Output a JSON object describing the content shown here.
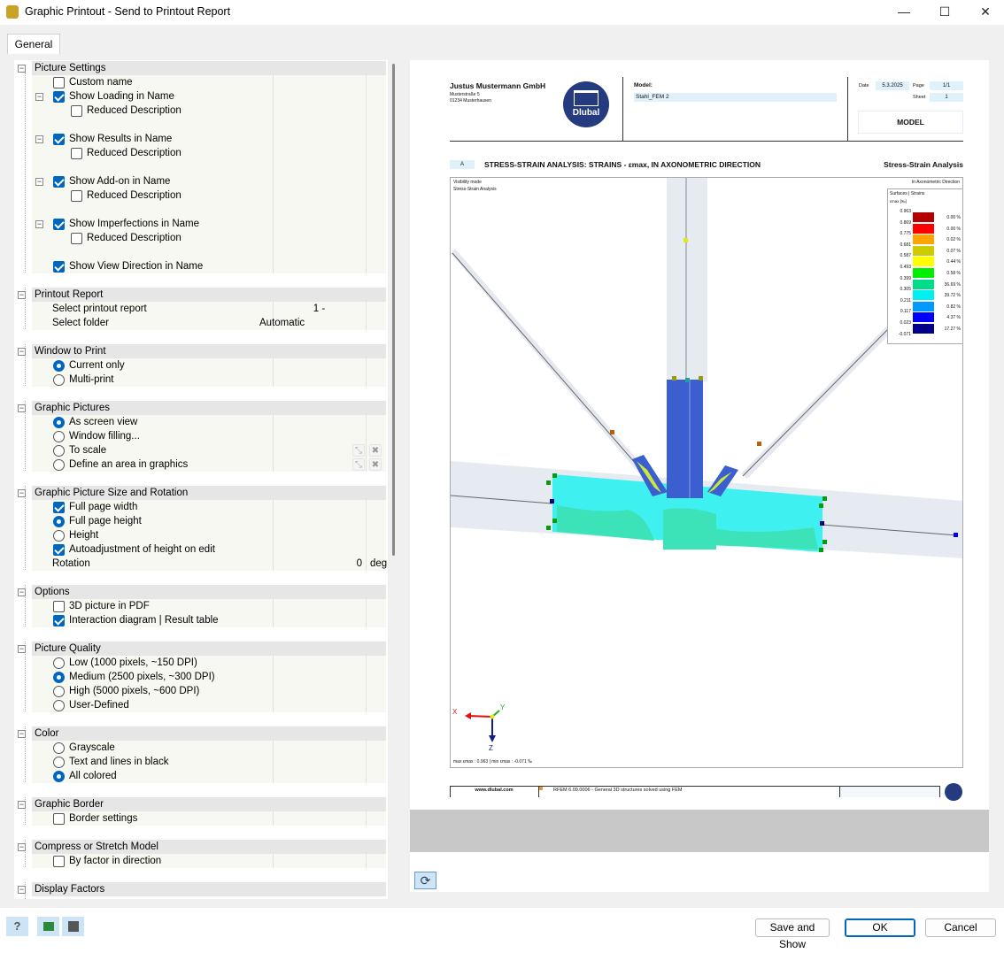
{
  "window": {
    "title": "Graphic Printout - Send to Printout Report",
    "minimize": "—",
    "maximize": "☐",
    "close": "✕"
  },
  "tabs": [
    {
      "label": "General"
    }
  ],
  "tree": [
    {
      "type": "hdr",
      "label": "Picture Settings"
    },
    {
      "type": "item",
      "level": 1,
      "ctl": "cb",
      "on": false,
      "label": "Custom name"
    },
    {
      "type": "item",
      "level": 1,
      "ctl": "cb",
      "on": true,
      "exp": true,
      "label": "Show Loading in Name"
    },
    {
      "type": "item",
      "level": 2,
      "ctl": "cb",
      "on": false,
      "label": "Reduced Description"
    },
    {
      "type": "item",
      "level": 1,
      "label": ""
    },
    {
      "type": "item",
      "level": 1,
      "ctl": "cb",
      "on": true,
      "exp": true,
      "label": "Show Results in Name"
    },
    {
      "type": "item",
      "level": 2,
      "ctl": "cb",
      "on": false,
      "label": "Reduced Description"
    },
    {
      "type": "item",
      "level": 1,
      "label": ""
    },
    {
      "type": "item",
      "level": 1,
      "ctl": "cb",
      "on": true,
      "exp": true,
      "label": "Show Add-on in Name"
    },
    {
      "type": "item",
      "level": 2,
      "ctl": "cb",
      "on": false,
      "label": "Reduced Description"
    },
    {
      "type": "item",
      "level": 1,
      "label": ""
    },
    {
      "type": "item",
      "level": 1,
      "ctl": "cb",
      "on": true,
      "exp": true,
      "label": "Show Imperfections in Name"
    },
    {
      "type": "item",
      "level": 2,
      "ctl": "cb",
      "on": false,
      "label": "Reduced Description"
    },
    {
      "type": "item",
      "level": 1,
      "label": ""
    },
    {
      "type": "item",
      "level": 1,
      "ctl": "cb",
      "on": true,
      "label": "Show View Direction in Name"
    },
    {
      "type": "blank"
    },
    {
      "type": "hdr",
      "label": "Printout Report"
    },
    {
      "type": "item",
      "level": 1,
      "ctl": "none",
      "label": "Select printout report",
      "value": "1 -",
      "valueAlign": "center"
    },
    {
      "type": "item",
      "level": 1,
      "ctl": "none",
      "label": "Select folder",
      "value": "Automatic"
    },
    {
      "type": "blank"
    },
    {
      "type": "hdr",
      "label": "Window to Print"
    },
    {
      "type": "item",
      "level": 1,
      "ctl": "rd",
      "on": true,
      "label": "Current only"
    },
    {
      "type": "item",
      "level": 1,
      "ctl": "rd",
      "on": false,
      "label": "Multi-print"
    },
    {
      "type": "blank"
    },
    {
      "type": "hdr",
      "label": "Graphic Pictures"
    },
    {
      "type": "item",
      "level": 1,
      "ctl": "rd",
      "on": true,
      "label": "As screen view"
    },
    {
      "type": "item",
      "level": 1,
      "ctl": "rd",
      "on": false,
      "label": "Window filling..."
    },
    {
      "type": "item",
      "level": 1,
      "ctl": "rd",
      "on": false,
      "label": "To scale",
      "icons": true
    },
    {
      "type": "item",
      "level": 1,
      "ctl": "rd",
      "on": false,
      "label": "Define an area in graphics",
      "icons": true
    },
    {
      "type": "blank"
    },
    {
      "type": "hdr",
      "label": "Graphic Picture Size and Rotation"
    },
    {
      "type": "item",
      "level": 1,
      "ctl": "cb",
      "on": true,
      "label": "Full page width"
    },
    {
      "type": "item",
      "level": 1,
      "ctl": "rd",
      "on": true,
      "label": "Full page height"
    },
    {
      "type": "item",
      "level": 1,
      "ctl": "rd",
      "on": false,
      "label": "Height"
    },
    {
      "type": "item",
      "level": 1,
      "ctl": "cb",
      "on": true,
      "label": "Autoadjustment of height on edit"
    },
    {
      "type": "item",
      "level": 1,
      "ctl": "none",
      "label": "Rotation",
      "value": "0",
      "valueAlign": "right",
      "unit": "deg"
    },
    {
      "type": "blank"
    },
    {
      "type": "hdr",
      "label": "Options"
    },
    {
      "type": "item",
      "level": 1,
      "ctl": "cb",
      "on": false,
      "label": "3D picture in PDF"
    },
    {
      "type": "item",
      "level": 1,
      "ctl": "cb",
      "on": true,
      "label": "Interaction diagram | Result table"
    },
    {
      "type": "blank"
    },
    {
      "type": "hdr",
      "label": "Picture Quality"
    },
    {
      "type": "item",
      "level": 1,
      "ctl": "rd",
      "on": false,
      "label": "Low (1000 pixels, ~150 DPI)"
    },
    {
      "type": "item",
      "level": 1,
      "ctl": "rd",
      "on": true,
      "label": "Medium (2500 pixels, ~300 DPI)"
    },
    {
      "type": "item",
      "level": 1,
      "ctl": "rd",
      "on": false,
      "label": "High (5000 pixels, ~600 DPI)"
    },
    {
      "type": "item",
      "level": 1,
      "ctl": "rd",
      "on": false,
      "label": "User-Defined"
    },
    {
      "type": "blank"
    },
    {
      "type": "hdr",
      "label": "Color"
    },
    {
      "type": "item",
      "level": 1,
      "ctl": "rd",
      "on": false,
      "label": "Grayscale"
    },
    {
      "type": "item",
      "level": 1,
      "ctl": "rd",
      "on": false,
      "label": "Text and lines in black"
    },
    {
      "type": "item",
      "level": 1,
      "ctl": "rd",
      "on": true,
      "label": "All colored"
    },
    {
      "type": "blank"
    },
    {
      "type": "hdr",
      "label": "Graphic Border"
    },
    {
      "type": "item",
      "level": 1,
      "ctl": "cb",
      "on": false,
      "label": "Border settings"
    },
    {
      "type": "blank"
    },
    {
      "type": "hdr",
      "label": "Compress or Stretch Model"
    },
    {
      "type": "item",
      "level": 1,
      "ctl": "cb",
      "on": false,
      "label": "By factor in direction"
    },
    {
      "type": "blank"
    },
    {
      "type": "hdr",
      "label": "Display Factors"
    }
  ],
  "preview": {
    "company": "Justus Mustermann GmbH",
    "street": "Musterstraße 5",
    "city": "01234 Musterhausen",
    "logo_text": "Dlubal",
    "model_label": "Model:",
    "model_value": "Stahl_FEM 2",
    "date_label": "Date",
    "date_value": "5.3.2025",
    "page_label": "Page",
    "page_value": "1/1",
    "sheet_label": "Sheet",
    "sheet_value": "1",
    "section_box": "MODEL",
    "chapter": "A",
    "heading": "STRESS-STRAIN ANALYSIS: STRAINS - εmax, IN AXONOMETRIC DIRECTION",
    "heading_right": "Stress-Strain Analysis",
    "vis_mode": "Visibility mode",
    "vis_sub": "Stress-Strain Analysis",
    "direction": "In Axonometric Direction",
    "legend_title": "Surfaces | Strains",
    "legend_unit": "εmax [‰]",
    "legend_values": [
      "0.963",
      "0.869",
      "0.775",
      "0.681",
      "0.587",
      "0.493",
      "0.399",
      "0.305",
      "0.211",
      "0.117",
      "0.023",
      "-0.071"
    ],
    "legend_colors": [
      "#b30000",
      "#ff0000",
      "#ffa500",
      "#cccc00",
      "#ffff00",
      "#00ee00",
      "#00dd88",
      "#00f0f0",
      "#0099ff",
      "#0000ff",
      "#00008b"
    ],
    "legend_percents": [
      "0.00 %",
      "0.00 %",
      "0.02 %",
      "0.07 %",
      "0.44 %",
      "0.58 %",
      "36.69 %",
      "39.72 %",
      "0.82 %",
      "4.37 %",
      "17.27 %"
    ],
    "axis_x": "X",
    "axis_y": "Y",
    "axis_z": "Z",
    "minmax": "max εmax : 0.963 | min εmax : -0.071 ‰",
    "footer_url": "www.dlubal.com",
    "footer_text": "RFEM 6.09.0006 - General 3D structures solved using FEM"
  },
  "buttons": {
    "refresh": "⟳",
    "save_show": "Save and Show",
    "ok": "OK",
    "cancel": "Cancel",
    "help": "?"
  }
}
